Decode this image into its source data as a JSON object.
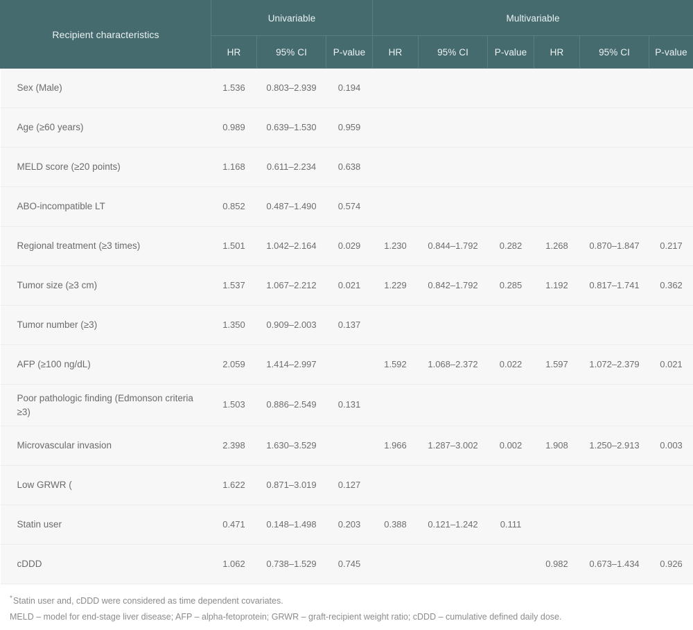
{
  "header": {
    "row_label": "Recipient characteristics",
    "groups": [
      {
        "label": "Univariable",
        "span": 3
      },
      {
        "label": "Multivariable",
        "span": 6
      }
    ],
    "subcolumns": [
      "HR",
      "95% CI",
      "P-value",
      "HR",
      "95% CI",
      "P-value",
      "HR",
      "95% CI",
      "P-value"
    ]
  },
  "rows": [
    {
      "label": "Sex (Male)",
      "uni_hr": "1.536",
      "uni_ci": "0.803–2.939",
      "uni_p": "0.194",
      "m1_hr": "",
      "m1_ci": "",
      "m1_p": "",
      "m2_hr": "",
      "m2_ci": "",
      "m2_p": ""
    },
    {
      "label": "Age (≥60 years)",
      "uni_hr": "0.989",
      "uni_ci": "0.639–1.530",
      "uni_p": "0.959",
      "m1_hr": "",
      "m1_ci": "",
      "m1_p": "",
      "m2_hr": "",
      "m2_ci": "",
      "m2_p": ""
    },
    {
      "label": "MELD score (≥20 points)",
      "uni_hr": "1.168",
      "uni_ci": "0.611–2.234",
      "uni_p": "0.638",
      "m1_hr": "",
      "m1_ci": "",
      "m1_p": "",
      "m2_hr": "",
      "m2_ci": "",
      "m2_p": ""
    },
    {
      "label": "ABO-incompatible LT",
      "uni_hr": "0.852",
      "uni_ci": "0.487–1.490",
      "uni_p": "0.574",
      "m1_hr": "",
      "m1_ci": "",
      "m1_p": "",
      "m2_hr": "",
      "m2_ci": "",
      "m2_p": ""
    },
    {
      "label": "Regional treatment (≥3 times)",
      "uni_hr": "1.501",
      "uni_ci": "1.042–2.164",
      "uni_p": "0.029",
      "m1_hr": "1.230",
      "m1_ci": "0.844–1.792",
      "m1_p": "0.282",
      "m2_hr": "1.268",
      "m2_ci": "0.870–1.847",
      "m2_p": "0.217"
    },
    {
      "label": "Tumor size (≥3 cm)",
      "uni_hr": "1.537",
      "uni_ci": "1.067–2.212",
      "uni_p": "0.021",
      "m1_hr": "1.229",
      "m1_ci": "0.842–1.792",
      "m1_p": "0.285",
      "m2_hr": "1.192",
      "m2_ci": "0.817–1.741",
      "m2_p": "0.362"
    },
    {
      "label": "Tumor number (≥3)",
      "uni_hr": "1.350",
      "uni_ci": "0.909–2.003",
      "uni_p": "0.137",
      "m1_hr": "",
      "m1_ci": "",
      "m1_p": "",
      "m2_hr": "",
      "m2_ci": "",
      "m2_p": ""
    },
    {
      "label": "AFP (≥100 ng/dL)",
      "uni_hr": "2.059",
      "uni_ci": "1.414–2.997",
      "uni_p": "",
      "m1_hr": "1.592",
      "m1_ci": "1.068–2.372",
      "m1_p": "0.022",
      "m2_hr": "1.597",
      "m2_ci": "1.072–2.379",
      "m2_p": "0.021"
    },
    {
      "label": "Poor pathologic finding (Edmonson criteria ≥3)",
      "uni_hr": "1.503",
      "uni_ci": "0.886–2.549",
      "uni_p": "0.131",
      "m1_hr": "",
      "m1_ci": "",
      "m1_p": "",
      "m2_hr": "",
      "m2_ci": "",
      "m2_p": ""
    },
    {
      "label": "Microvascular invasion",
      "uni_hr": "2.398",
      "uni_ci": "1.630–3.529",
      "uni_p": "",
      "m1_hr": "1.966",
      "m1_ci": "1.287–3.002",
      "m1_p": "0.002",
      "m2_hr": "1.908",
      "m2_ci": "1.250–2.913",
      "m2_p": "0.003"
    },
    {
      "label": "Low GRWR (",
      "uni_hr": "1.622",
      "uni_ci": "0.871–3.019",
      "uni_p": "0.127",
      "m1_hr": "",
      "m1_ci": "",
      "m1_p": "",
      "m2_hr": "",
      "m2_ci": "",
      "m2_p": ""
    },
    {
      "label": "Statin user",
      "uni_hr": "0.471",
      "uni_ci": "0.148–1.498",
      "uni_p": "0.203",
      "m1_hr": "0.388",
      "m1_ci": "0.121–1.242",
      "m1_p": "0.111",
      "m2_hr": "",
      "m2_ci": "",
      "m2_p": ""
    },
    {
      "label": "cDDD",
      "uni_hr": "1.062",
      "uni_ci": "0.738–1.529",
      "uni_p": "0.745",
      "m1_hr": "",
      "m1_ci": "",
      "m1_p": "",
      "m2_hr": "0.982",
      "m2_ci": "0.673–1.434",
      "m2_p": "0.926"
    }
  ],
  "footnotes": {
    "star_marker": "*",
    "line1": "Statin user and, cDDD were considered as time dependent covariates.",
    "line2": "MELD – model for end-stage liver disease; AFP – alpha-fetoprotein; GRWR – graft-recipient weight ratio; cDDD – cumulative defined daily dose."
  },
  "colors": {
    "header_bg": "#456b6f",
    "header_text": "#ecf2f2",
    "row_bg": "#f7f7f7",
    "body_text": "#6e6e6e",
    "footnote_text": "#8b8b8b"
  }
}
